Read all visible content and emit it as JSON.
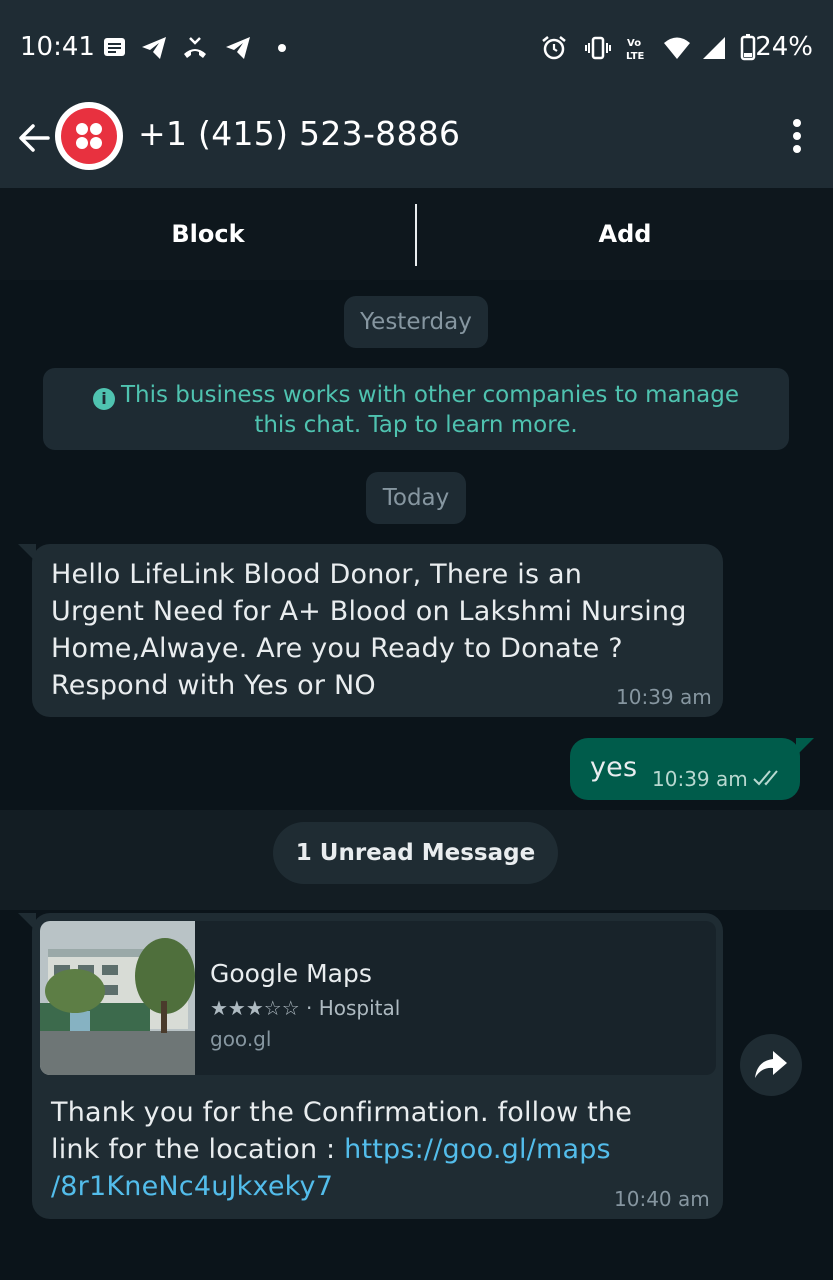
{
  "status_bar": {
    "time": "10:41",
    "battery": "24%"
  },
  "header": {
    "contact": "+1 (415) 523-8886"
  },
  "actions": {
    "block": "Block",
    "add": "Add"
  },
  "chat": {
    "date_yesterday": "Yesterday",
    "info_banner": "This business works with other companies to manage this chat. Tap to learn more.",
    "date_today": "Today",
    "messages": [
      {
        "direction": "incoming",
        "lines": [
          "Hello LifeLink Blood Donor, There is an",
          "Urgent Need for A+ Blood on Lakshmi Nursing",
          "Home,Alwaye. Are you Ready to Donate ?",
          "Respond with Yes or NO"
        ],
        "time": "10:39 am"
      },
      {
        "direction": "outgoing",
        "text": "yes",
        "time": "10:39 am",
        "status": "read"
      },
      {
        "direction": "incoming",
        "preview": {
          "title": "Google Maps",
          "stars": "★★★☆☆",
          "subtitle": " · Hospital",
          "domain": "goo.gl"
        },
        "text_line1": "Thank you for the Confirmation. follow the",
        "text_line2": "link for the location : ",
        "link_part1": "https://goo.gl/maps",
        "link_part2": "/8r1KneNc4uJkxeky7",
        "time": "10:40 am"
      }
    ],
    "unread": "1 Unread Message"
  },
  "colors": {
    "header": "#1f2c34",
    "background": "#0b141a",
    "bubble_in": "#1f2c33",
    "bubble_out": "#005c4b",
    "link": "#53bdeb",
    "info_text": "#4fc3b0",
    "avatar": "#e8313f"
  }
}
